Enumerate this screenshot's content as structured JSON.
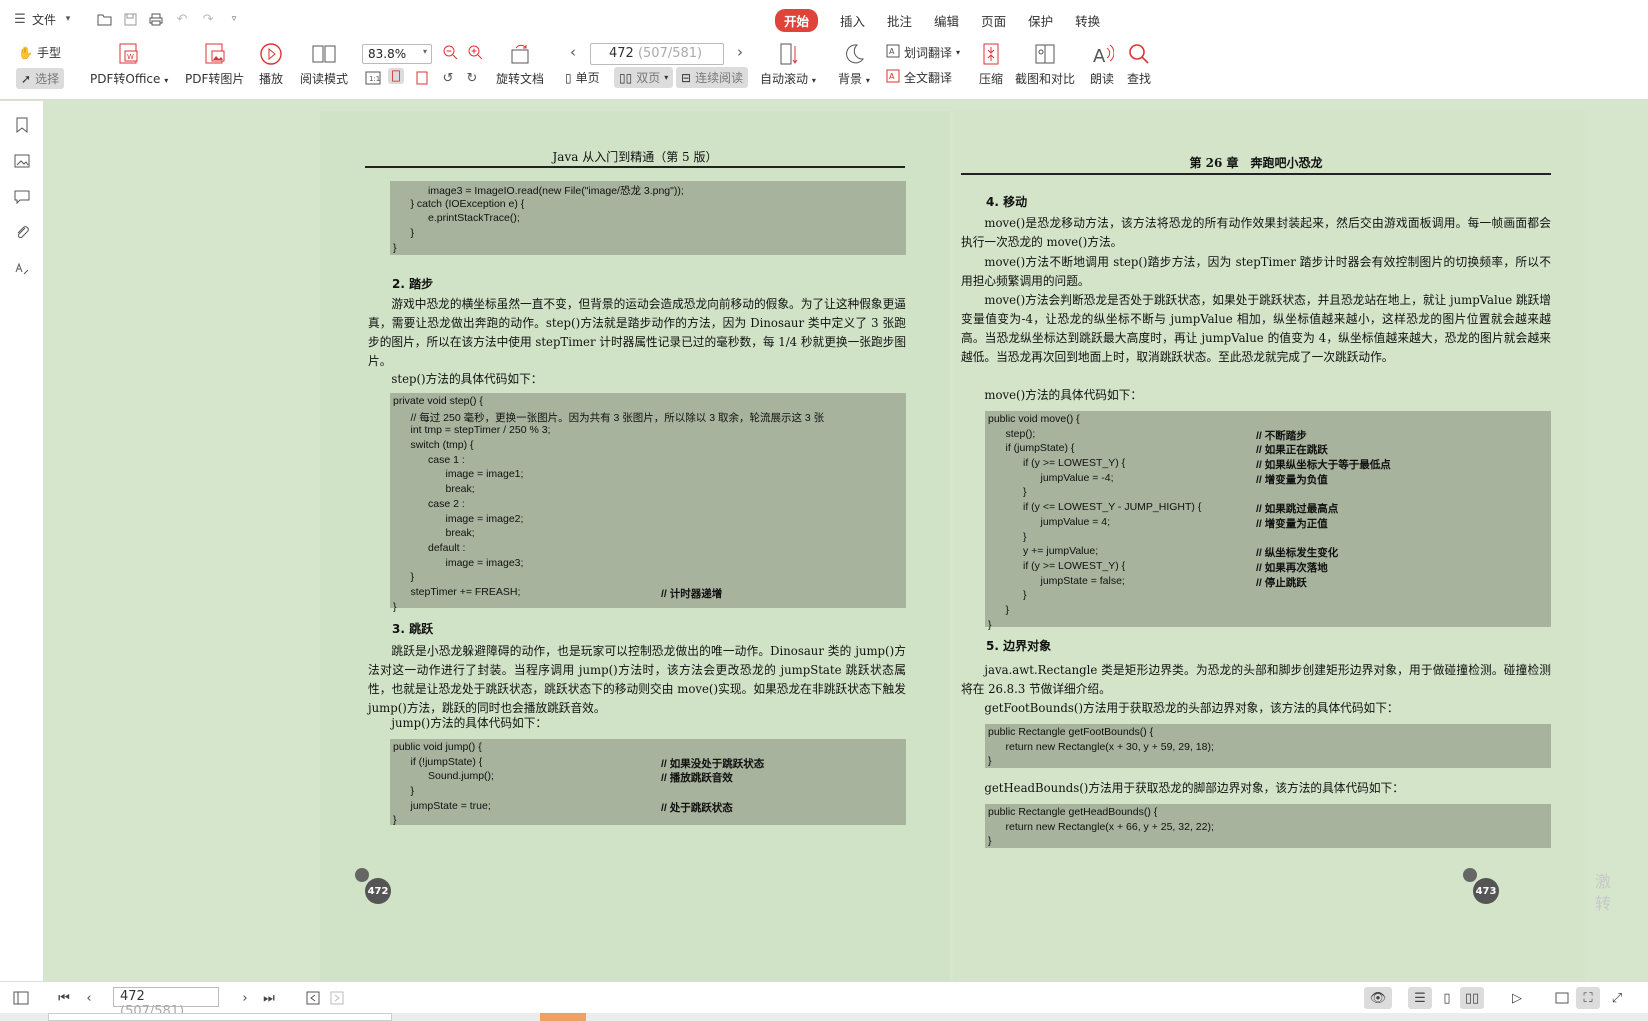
{
  "menubar": {
    "file_label": "文件",
    "tabs": [
      "开始",
      "插入",
      "批注",
      "编辑",
      "页面",
      "保护",
      "转换"
    ],
    "active_tab": "开始"
  },
  "toolbar": {
    "hand_label": "手型",
    "select_label": "选择",
    "pdf_to_office": "PDF转Office",
    "pdf_to_image": "PDF转图片",
    "play": "播放",
    "read_mode": "阅读模式",
    "zoom_value": "83.8%",
    "rotate_doc": "旋转文档",
    "page_current": "472",
    "page_total": "(507/581)",
    "single_page": "单页",
    "double_page": "双页",
    "continuous": "连续阅读",
    "auto_scroll": "自动滚动",
    "background": "背景",
    "word_translate": "划词翻译",
    "full_translate": "全文翻译",
    "compress": "压缩",
    "screenshot_compare": "截图和对比",
    "read_aloud": "朗读",
    "search": "查找"
  },
  "left_page": {
    "running_head": "Java 从入门到精通（第 5 版）",
    "code1": [
      {
        "t": "            image3 = ImageIO.read(new File(\"image/恐龙 3.png\"));",
        "c": ""
      },
      {
        "t": "      } catch (IOException e) {",
        "c": ""
      },
      {
        "t": "            e.printStackTrace();",
        "c": ""
      },
      {
        "t": "      }",
        "c": ""
      },
      {
        "t": "}",
        "c": ""
      }
    ],
    "h2": "2. 踏步",
    "p1": "游戏中恐龙的横坐标虽然一直不变，但背景的运动会造成恐龙向前移动的假象。为了让这种假象更逼真，需要让恐龙做出奔跑的动作。step()方法就是踏步动作的方法，因为 Dinosaur 类中定义了 3 张跑步的图片，所以在该方法中使用 stepTimer 计时器属性记录已过的毫秒数，每 1/4 秒就更换一张跑步图片。",
    "p2": "step()方法的具体代码如下：",
    "code2": [
      {
        "t": "private void step() {",
        "c": ""
      },
      {
        "t": "      // 每过 250 毫秒，更换一张图片。因为共有 3 张图片，所以除以 3 取余，轮流展示这 3 张",
        "c": ""
      },
      {
        "t": "      int tmp = stepTimer / 250 % 3;",
        "c": ""
      },
      {
        "t": "      switch (tmp) {",
        "c": ""
      },
      {
        "t": "            case 1 :",
        "c": ""
      },
      {
        "t": "                  image = image1;",
        "c": ""
      },
      {
        "t": "                  break;",
        "c": ""
      },
      {
        "t": "            case 2 :",
        "c": ""
      },
      {
        "t": "                  image = image2;",
        "c": ""
      },
      {
        "t": "                  break;",
        "c": ""
      },
      {
        "t": "            default :",
        "c": ""
      },
      {
        "t": "                  image = image3;",
        "c": ""
      },
      {
        "t": "      }",
        "c": ""
      },
      {
        "t": "      stepTimer += FREASH;",
        "c": "// 计时器递增"
      },
      {
        "t": "}",
        "c": ""
      }
    ],
    "h3": "3. 跳跃",
    "p3": "跳跃是小恐龙躲避障碍的动作，也是玩家可以控制恐龙做出的唯一动作。Dinosaur 类的 jump()方法对这一动作进行了封装。当程序调用 jump()方法时，该方法会更改恐龙的 jumpState 跳跃状态属性，也就是让恐龙处于跳跃状态，跳跃状态下的移动则交由 move()实现。如果恐龙在非跳跃状态下触发 jump()方法，跳跃的同时也会播放跳跃音效。",
    "p4": "jump()方法的具体代码如下：",
    "code3": [
      {
        "t": "public void jump() {",
        "c": ""
      },
      {
        "t": "      if (!jumpState) {",
        "c": "// 如果没处于跳跃状态"
      },
      {
        "t": "            Sound.jump();",
        "c": "// 播放跳跃音效"
      },
      {
        "t": "      }",
        "c": ""
      },
      {
        "t": "      jumpState = true;",
        "c": "// 处于跳跃状态"
      },
      {
        "t": "}",
        "c": ""
      }
    ],
    "page_number": "472"
  },
  "right_page": {
    "running_head": "第 26 章　奔跑吧小恐龙",
    "h4": "4. 移动",
    "p1": "move()是恐龙移动方法，该方法将恐龙的所有动作效果封装起来，然后交由游戏面板调用。每一帧画面都会执行一次恐龙的 move()方法。",
    "p2": "move()方法不断地调用 step()踏步方法，因为 stepTimer 踏步计时器会有效控制图片的切换频率，所以不用担心频繁调用的问题。",
    "p3": "move()方法会判断恐龙是否处于跳跃状态，如果处于跳跃状态，并且恐龙站在地上，就让 jumpValue 跳跃增变量值变为-4，让恐龙的纵坐标不断与 jumpValue 相加，纵坐标值越来越小，这样恐龙的图片位置就会越来越高。当恐龙纵坐标达到跳跃最大高度时，再让 jumpValue 的值变为 4，纵坐标值越来越大，恐龙的图片就会越来越低。当恐龙再次回到地面上时，取消跳跃状态。至此恐龙就完成了一次跳跃动作。",
    "p4": "move()方法的具体代码如下：",
    "code1": [
      {
        "t": "public void move() {",
        "c": ""
      },
      {
        "t": "      step();",
        "c": "// 不断踏步"
      },
      {
        "t": "      if (jumpState) {",
        "c": "// 如果正在跳跃"
      },
      {
        "t": "            if (y >= LOWEST_Y) {",
        "c": "// 如果纵坐标大于等于最低点"
      },
      {
        "t": "                  jumpValue = -4;",
        "c": "// 增变量为负值"
      },
      {
        "t": "            }",
        "c": ""
      },
      {
        "t": "            if (y <= LOWEST_Y - JUMP_HIGHT) {",
        "c": "// 如果跳过最高点"
      },
      {
        "t": "                  jumpValue = 4;",
        "c": "// 增变量为正值"
      },
      {
        "t": "            }",
        "c": ""
      },
      {
        "t": "            y += jumpValue;",
        "c": "// 纵坐标发生变化"
      },
      {
        "t": "            if (y >= LOWEST_Y) {",
        "c": "// 如果再次落地"
      },
      {
        "t": "                  jumpState = false;",
        "c": "// 停止跳跃"
      },
      {
        "t": "            }",
        "c": ""
      },
      {
        "t": "      }",
        "c": ""
      },
      {
        "t": "}",
        "c": ""
      }
    ],
    "h5": "5. 边界对象",
    "p5": "java.awt.Rectangle 类是矩形边界类。为恐龙的头部和脚步创建矩形边界对象，用于做碰撞检测。碰撞检测将在 26.8.3 节做详细介绍。",
    "p6": "getFootBounds()方法用于获取恐龙的头部边界对象，该方法的具体代码如下：",
    "code2": [
      {
        "t": "public Rectangle getFootBounds() {",
        "c": ""
      },
      {
        "t": "      return new Rectangle(x + 30, y + 59, 29, 18);",
        "c": ""
      },
      {
        "t": "}",
        "c": ""
      }
    ],
    "p7": "getHeadBounds()方法用于获取恐龙的脚部边界对象，该方法的具体代码如下：",
    "code3": [
      {
        "t": "public Rectangle getHeadBounds() {",
        "c": ""
      },
      {
        "t": "      return new Rectangle(x + 66, y + 25, 32, 22);",
        "c": ""
      },
      {
        "t": "}",
        "c": ""
      }
    ],
    "page_number": "473"
  },
  "statusbar": {
    "page_current": "472",
    "page_total": "(507/581)"
  },
  "watermark": "激\n转"
}
